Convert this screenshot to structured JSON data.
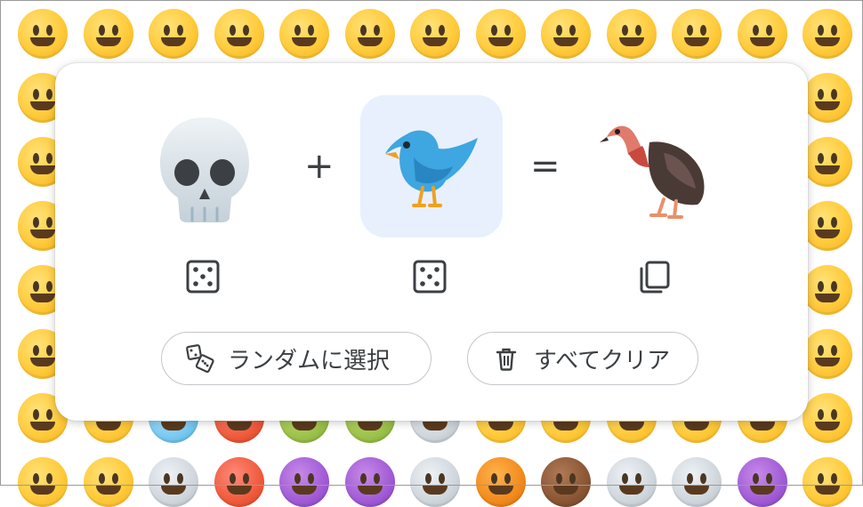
{
  "operators": {
    "plus": "+",
    "equals": "="
  },
  "mixer": {
    "left_emoji": {
      "name": "skull-icon"
    },
    "middle_emoji": {
      "name": "blue-bird-icon",
      "selected": true
    },
    "result_emoji": {
      "name": "vulture-icon"
    }
  },
  "controls": {
    "left_dice": {
      "icon": "dice-icon"
    },
    "middle_dice": {
      "icon": "dice-icon"
    },
    "copy": {
      "icon": "copy-icon"
    }
  },
  "buttons": {
    "random_label": "ランダムに選択",
    "clear_label": "すべてクリア"
  },
  "colors": {
    "selected_slot_bg": "#e8f0fe",
    "text": "#3c4043",
    "border": "#c4c7cc"
  }
}
